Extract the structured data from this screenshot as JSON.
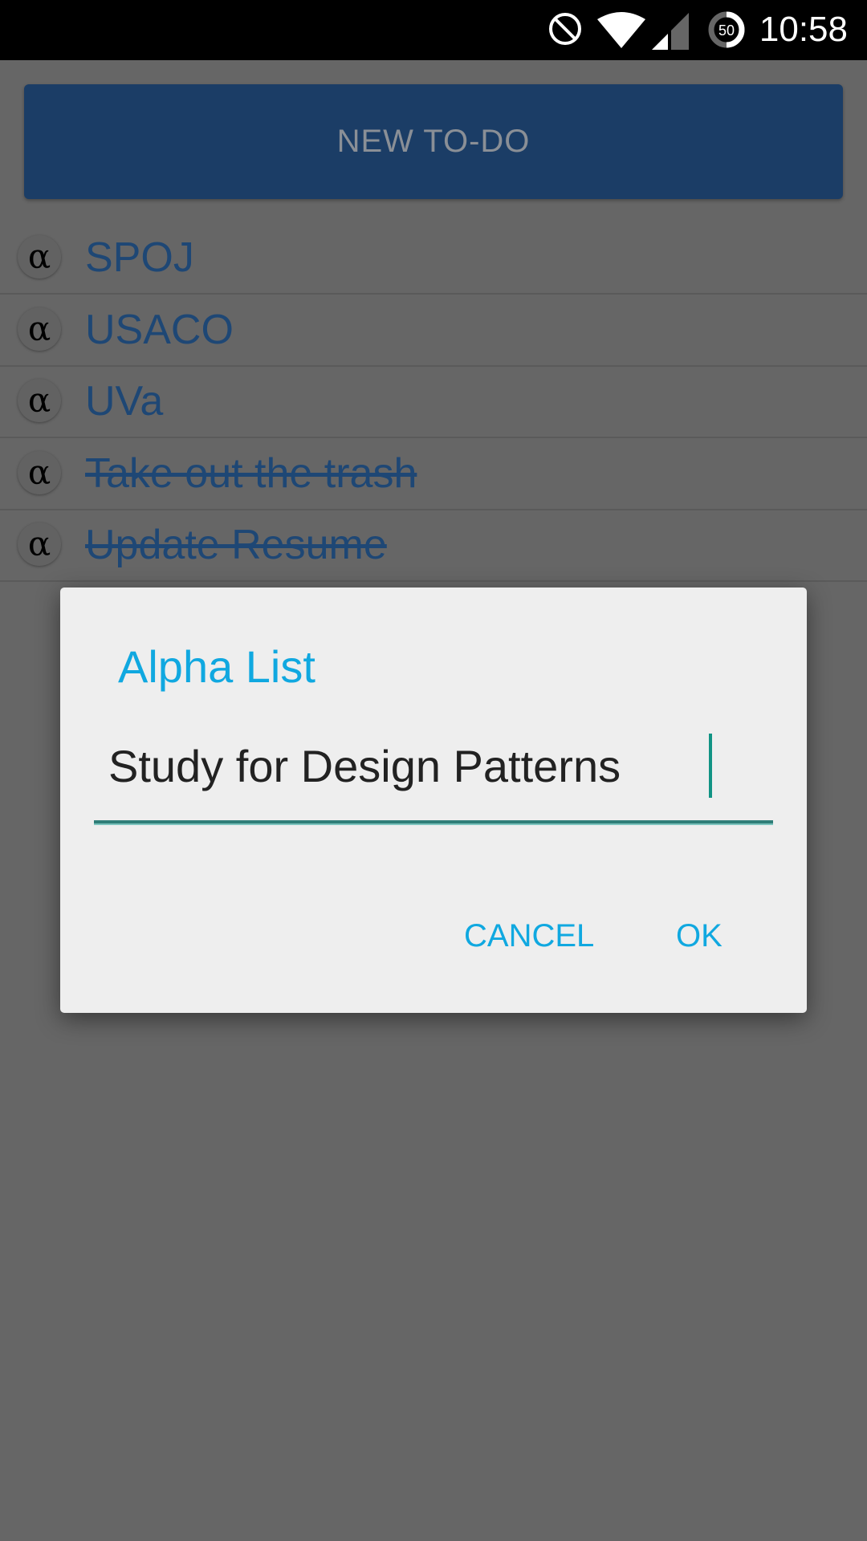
{
  "status_bar": {
    "time": "10:58",
    "battery_level": "50",
    "icons": [
      "do-not-disturb-icon",
      "wifi-icon",
      "cell-signal-icon",
      "battery-icon"
    ]
  },
  "new_todo_button": {
    "label": "NEW TO-DO"
  },
  "list": {
    "items": [
      {
        "icon": "α",
        "label": "SPOJ",
        "done": false
      },
      {
        "icon": "α",
        "label": "USACO",
        "done": false
      },
      {
        "icon": "α",
        "label": "UVa",
        "done": false
      },
      {
        "icon": "α",
        "label": "Take out the trash",
        "done": true
      },
      {
        "icon": "α",
        "label": "Update Resume",
        "done": true
      }
    ]
  },
  "dialog": {
    "title": "Alpha List",
    "input_value": "Study for Design Patterns",
    "cancel_label": "CANCEL",
    "ok_label": "OK"
  },
  "colors": {
    "accent": "#10a8e0",
    "input_underline": "#2f7e78",
    "item_text": "#1e4775",
    "button_bg": "#1b3d66"
  }
}
